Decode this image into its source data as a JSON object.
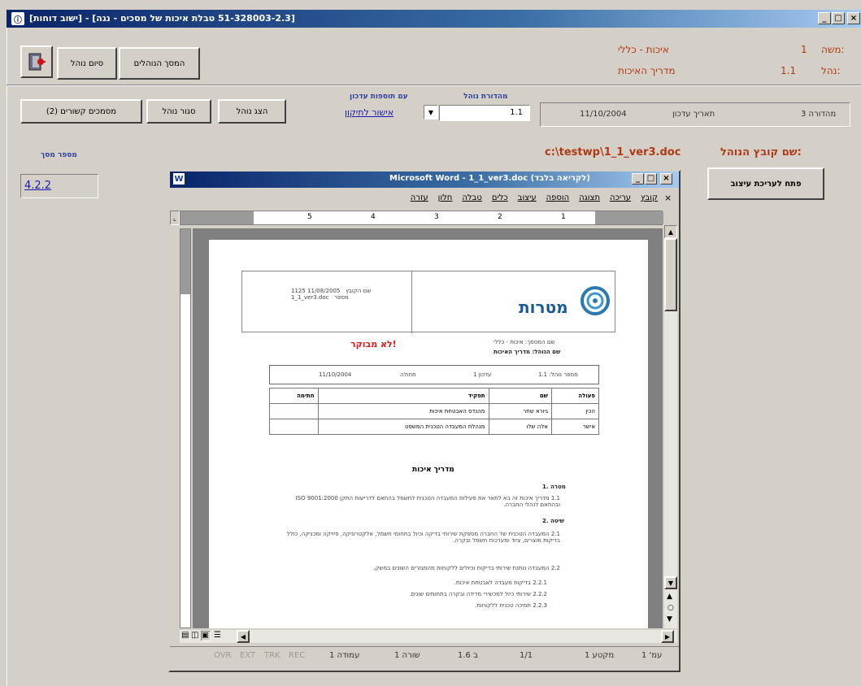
{
  "window": {
    "title": "[ישוב דוחות] - [51-328003-2.3 טבלת איכות של מסכים - נגה]",
    "controls": {
      "min": "_",
      "max": "□",
      "close": "×"
    }
  },
  "header": {
    "field1_label": "משה:",
    "field1_value": "1",
    "field2_label": "נהל:",
    "field2_value": "1.1",
    "field3_label": "איכות - כללי",
    "field4_label": "מדריך האיכות"
  },
  "toolbar": {
    "exit_label": "",
    "exit_procedure_label": "סיום נוהל",
    "back_to_procedures_label": "המסך הנוהלים",
    "show_procedure_label": "הצג נוהל",
    "close_procedure_label": "סגור נוהל",
    "related_docs_label": "מסמכים קשורים (2)"
  },
  "revision": {
    "label_top": "מהדורת נוהל",
    "value": "1.1",
    "update_label": "עם תוספות עדכון",
    "update_link": "אישור לתיקון",
    "date_label": "תאריך עדכון",
    "date_value": "11/10/2004",
    "edition_label": "מהדורה 3"
  },
  "file_path": {
    "label": "שם קובץ הנוהל:",
    "value": "c:\\testwp\\1_1_ver3.doc"
  },
  "edit_button_label": "פתח לעריכת עיצוב",
  "left_panel": {
    "label": "מספר מסך",
    "value": "4.2.2"
  },
  "word": {
    "title": "Microsoft Word - 1_1_ver3.doc (לקריאה בלבד)",
    "menu": [
      "קובץ",
      "עריכה",
      "תצוגה",
      "הוספה",
      "עיצוב",
      "כלים",
      "טבלה",
      "חלון",
      "עזרה"
    ],
    "ruler_numbers": [
      "1",
      "2",
      "3",
      "4",
      "5"
    ],
    "status": {
      "page": "עמ' 1",
      "section": "מקטע 1",
      "pages": "1/1",
      "at": "ב 1.6",
      "line": "שורה 1",
      "col": "עמודה 1",
      "rec": "REC",
      "trk": "TRK",
      "ext": "EXT",
      "ovr": "OVR"
    },
    "doc": {
      "logo": "מטרות",
      "header_box": "1125 11/08/2005   שם הקובץ\n1_1_ver3.doc   מספר",
      "not_controlled": "לא מבוקר!",
      "proc_name_line1": "שם המסמך: איכות - כללי",
      "proc_name_line2": "שם הנוהל: מדריך האיכות",
      "info_row": {
        "num_label": "מספר נוהל: 1.1",
        "rev_label": "עדכון 1",
        "valid_label": "תחולה",
        "date": "11/10/2004"
      },
      "table_headers": [
        "פעולה",
        "שם",
        "תפקיד",
        "חתימה"
      ],
      "table_rows": [
        [
          "הכין",
          "גיורא שחר",
          "מהנדס האבטחת איכות",
          ""
        ],
        [
          "אישר",
          "אלה שלו",
          "מנהלת המעבדה הטכנית המשפט",
          ""
        ]
      ],
      "doc_title": "מדריך איכות",
      "s1_title": "1. מטרה",
      "s1_text": "1.1 מדריך איכות זה בא לתאר את פעילות המעבדה הטכנית לחשמל בהתאם לדרישות התקן ISO 9001:2000 ובהתאם לנהלי החברה.",
      "s2_title": "2. שיטה",
      "s2_text": "2.1 המעבדה הטכנית של החברה מספקת שירותי בדיקה וכיול בתחומי חשמל, אלקטרוניקה, פיזיקה ומכניקה, כולל בדיקות מוצרים, ציוד ומערכות חשמל ובקרה.",
      "s2_2": "2.2 המעבדה נותנת שירותי בדיקות וכיולים ללקוחות מהמגזרים השונים במשק.",
      "s2_2_1": "2.2.1 בדיקות מעבדה לאבטחת איכות.",
      "s2_2_2": "2.2.2 שירותי כיול למכשירי מדידה ובקרה בתחומים שונים.",
      "s2_2_3": "2.2.3 תמיכה טכנית ללקוחות."
    }
  }
}
